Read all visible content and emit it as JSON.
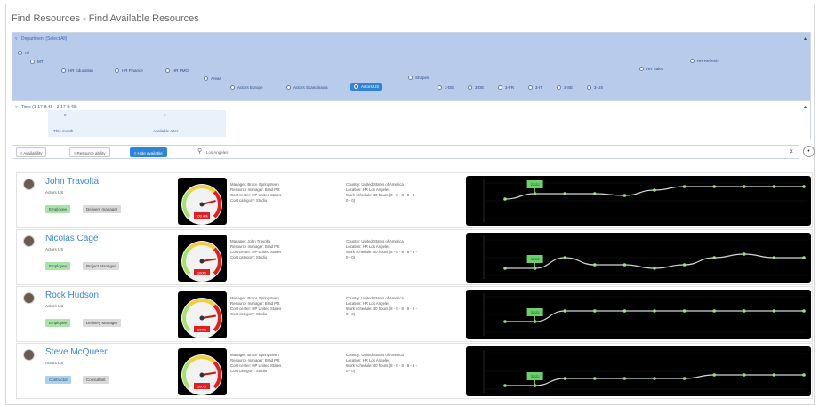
{
  "page": {
    "title": "Find Resources - Find Available Resources"
  },
  "dept_panel": {
    "header": "Department (Select All)",
    "root": "All",
    "level1": "MT",
    "nodes_l2": [
      "HR Education",
      "HR Finance",
      "HR PMO"
    ],
    "node_areas": "Areas",
    "nodes_areas": [
      "Actors Europe",
      "Actors Scandinavia",
      "Actors US"
    ],
    "node_shapes": "Shapes",
    "nodes_shapes": [
      "3-DE",
      "3-DE",
      "3-FR",
      "3-IT",
      "3-SE",
      "3-US"
    ],
    "node_sales": "HR Sales",
    "node_refresh": "HR Refresh",
    "selected": "Actors US"
  },
  "time_panel": {
    "header": "Time (1-17-8:48 - 3-17-8:48)",
    "left_label": "This month",
    "right_label": "Available after",
    "left_value": "0",
    "right_value": "1"
  },
  "filters": {
    "buttons": [
      "Availability",
      "Resource ability",
      "Hide available"
    ],
    "search_value": "Los Angeles"
  },
  "resources": [
    {
      "name": "John Travolta",
      "status": "Actors US",
      "tags": [
        {
          "label": "Employee",
          "color": "green"
        },
        {
          "label": "Delivery manager",
          "color": "gray"
        }
      ],
      "gauge_value": 0.78,
      "gauge_label": "100.4%",
      "manager": "Manager: Bruce Springsteen",
      "resource_manager": "Resource manager: Brad Pitt",
      "cost_center": "Cost center: HP United States",
      "cost_category": "Cost category: Studio",
      "country": "Country: United States of America",
      "location": "Location: HR Los Angeles",
      "schedule": "Work schedule: 40 hours (8 - 8 - 8 - 8 - 8 -",
      "schedule2": "0 - 0)",
      "tooltip": "27/22",
      "series": [
        55,
        70,
        70,
        70,
        65,
        80,
        90,
        90,
        90,
        90,
        90
      ]
    },
    {
      "name": "Nicolas Cage",
      "status": "Actors US",
      "tags": [
        {
          "label": "Employee",
          "color": "green"
        },
        {
          "label": "Project Manager",
          "color": "gray"
        }
      ],
      "gauge_value": 0.8,
      "gauge_label": "100%",
      "manager": "Manager: John Travolta",
      "resource_manager": "Resource manager: Brad Pitt",
      "cost_center": "Cost center: HP United States",
      "cost_category": "Cost category: Studio",
      "country": "Country: United States of America",
      "location": "Location: HR Los Angeles",
      "schedule": "Work schedule: 40 hours (8 - 8 - 8 - 8 - 8 -",
      "schedule2": "0 - 0)",
      "tooltip": "37/22",
      "series": [
        20,
        20,
        50,
        30,
        30,
        20,
        30,
        50,
        60,
        50,
        50
      ]
    },
    {
      "name": "Rock Hudson",
      "status": "Actors US",
      "tags": [
        {
          "label": "Employee",
          "color": "green"
        },
        {
          "label": "Delivery Manager",
          "color": "gray"
        }
      ],
      "gauge_value": 0.8,
      "gauge_label": "100%",
      "manager": "Manager: Bruce Springsteen",
      "resource_manager": "Resource manager: Brad Pitt",
      "cost_center": "Cost center: HP United States",
      "cost_category": "Cost category: Studio",
      "country": "Country: United States of America",
      "location": "Location: HR Los Angeles",
      "schedule": "Work schedule: 40 hours (8 - 8 - 8 - 8 - 8 -",
      "schedule2": "0 - 0)",
      "tooltip": "37/22",
      "series": [
        30,
        30,
        60,
        60,
        60,
        60,
        60,
        60,
        60,
        60,
        60
      ]
    },
    {
      "name": "Steve McQueen",
      "status": "Actors US",
      "tags": [
        {
          "label": "Contractor",
          "color": "blue"
        },
        {
          "label": "Consultant",
          "color": "gray"
        }
      ],
      "gauge_value": 0.8,
      "gauge_label": "100%",
      "manager": "Manager: Bruce Springsteen",
      "resource_manager": "Resource manager: Brad Pitt",
      "cost_center": "Cost center: HP United States",
      "cost_category": "Cost category: Studio",
      "country": "Country: United States of America",
      "location": "Location: HR Los Angeles",
      "schedule": "Work schedule: 40 hours (8 - 8 - 8 - 8 - 8 -",
      "schedule2": "0 - 0)",
      "tooltip": "37/22",
      "series": [
        10,
        10,
        30,
        30,
        30,
        30,
        30,
        40,
        40,
        40,
        40
      ]
    }
  ],
  "colors": {
    "accent": "#2f84d8",
    "chart_line": "#cfd8d8",
    "chart_point": "#a6e36b",
    "gauge_red": "#e02020"
  }
}
